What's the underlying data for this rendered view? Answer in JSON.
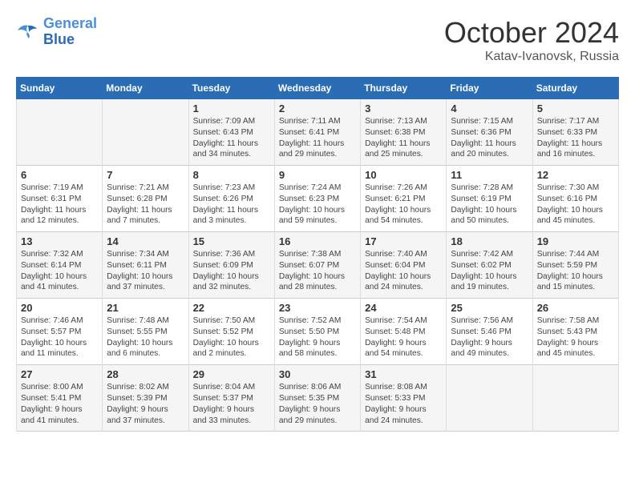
{
  "header": {
    "logo_line1": "General",
    "logo_line2": "Blue",
    "month": "October 2024",
    "location": "Katav-Ivanovsk, Russia"
  },
  "days_of_week": [
    "Sunday",
    "Monday",
    "Tuesday",
    "Wednesday",
    "Thursday",
    "Friday",
    "Saturday"
  ],
  "weeks": [
    [
      {
        "day": "",
        "content": ""
      },
      {
        "day": "",
        "content": ""
      },
      {
        "day": "1",
        "content": "Sunrise: 7:09 AM\nSunset: 6:43 PM\nDaylight: 11 hours\nand 34 minutes."
      },
      {
        "day": "2",
        "content": "Sunrise: 7:11 AM\nSunset: 6:41 PM\nDaylight: 11 hours\nand 29 minutes."
      },
      {
        "day": "3",
        "content": "Sunrise: 7:13 AM\nSunset: 6:38 PM\nDaylight: 11 hours\nand 25 minutes."
      },
      {
        "day": "4",
        "content": "Sunrise: 7:15 AM\nSunset: 6:36 PM\nDaylight: 11 hours\nand 20 minutes."
      },
      {
        "day": "5",
        "content": "Sunrise: 7:17 AM\nSunset: 6:33 PM\nDaylight: 11 hours\nand 16 minutes."
      }
    ],
    [
      {
        "day": "6",
        "content": "Sunrise: 7:19 AM\nSunset: 6:31 PM\nDaylight: 11 hours\nand 12 minutes."
      },
      {
        "day": "7",
        "content": "Sunrise: 7:21 AM\nSunset: 6:28 PM\nDaylight: 11 hours\nand 7 minutes."
      },
      {
        "day": "8",
        "content": "Sunrise: 7:23 AM\nSunset: 6:26 PM\nDaylight: 11 hours\nand 3 minutes."
      },
      {
        "day": "9",
        "content": "Sunrise: 7:24 AM\nSunset: 6:23 PM\nDaylight: 10 hours\nand 59 minutes."
      },
      {
        "day": "10",
        "content": "Sunrise: 7:26 AM\nSunset: 6:21 PM\nDaylight: 10 hours\nand 54 minutes."
      },
      {
        "day": "11",
        "content": "Sunrise: 7:28 AM\nSunset: 6:19 PM\nDaylight: 10 hours\nand 50 minutes."
      },
      {
        "day": "12",
        "content": "Sunrise: 7:30 AM\nSunset: 6:16 PM\nDaylight: 10 hours\nand 45 minutes."
      }
    ],
    [
      {
        "day": "13",
        "content": "Sunrise: 7:32 AM\nSunset: 6:14 PM\nDaylight: 10 hours\nand 41 minutes."
      },
      {
        "day": "14",
        "content": "Sunrise: 7:34 AM\nSunset: 6:11 PM\nDaylight: 10 hours\nand 37 minutes."
      },
      {
        "day": "15",
        "content": "Sunrise: 7:36 AM\nSunset: 6:09 PM\nDaylight: 10 hours\nand 32 minutes."
      },
      {
        "day": "16",
        "content": "Sunrise: 7:38 AM\nSunset: 6:07 PM\nDaylight: 10 hours\nand 28 minutes."
      },
      {
        "day": "17",
        "content": "Sunrise: 7:40 AM\nSunset: 6:04 PM\nDaylight: 10 hours\nand 24 minutes."
      },
      {
        "day": "18",
        "content": "Sunrise: 7:42 AM\nSunset: 6:02 PM\nDaylight: 10 hours\nand 19 minutes."
      },
      {
        "day": "19",
        "content": "Sunrise: 7:44 AM\nSunset: 5:59 PM\nDaylight: 10 hours\nand 15 minutes."
      }
    ],
    [
      {
        "day": "20",
        "content": "Sunrise: 7:46 AM\nSunset: 5:57 PM\nDaylight: 10 hours\nand 11 minutes."
      },
      {
        "day": "21",
        "content": "Sunrise: 7:48 AM\nSunset: 5:55 PM\nDaylight: 10 hours\nand 6 minutes."
      },
      {
        "day": "22",
        "content": "Sunrise: 7:50 AM\nSunset: 5:52 PM\nDaylight: 10 hours\nand 2 minutes."
      },
      {
        "day": "23",
        "content": "Sunrise: 7:52 AM\nSunset: 5:50 PM\nDaylight: 9 hours\nand 58 minutes."
      },
      {
        "day": "24",
        "content": "Sunrise: 7:54 AM\nSunset: 5:48 PM\nDaylight: 9 hours\nand 54 minutes."
      },
      {
        "day": "25",
        "content": "Sunrise: 7:56 AM\nSunset: 5:46 PM\nDaylight: 9 hours\nand 49 minutes."
      },
      {
        "day": "26",
        "content": "Sunrise: 7:58 AM\nSunset: 5:43 PM\nDaylight: 9 hours\nand 45 minutes."
      }
    ],
    [
      {
        "day": "27",
        "content": "Sunrise: 8:00 AM\nSunset: 5:41 PM\nDaylight: 9 hours\nand 41 minutes."
      },
      {
        "day": "28",
        "content": "Sunrise: 8:02 AM\nSunset: 5:39 PM\nDaylight: 9 hours\nand 37 minutes."
      },
      {
        "day": "29",
        "content": "Sunrise: 8:04 AM\nSunset: 5:37 PM\nDaylight: 9 hours\nand 33 minutes."
      },
      {
        "day": "30",
        "content": "Sunrise: 8:06 AM\nSunset: 5:35 PM\nDaylight: 9 hours\nand 29 minutes."
      },
      {
        "day": "31",
        "content": "Sunrise: 8:08 AM\nSunset: 5:33 PM\nDaylight: 9 hours\nand 24 minutes."
      },
      {
        "day": "",
        "content": ""
      },
      {
        "day": "",
        "content": ""
      }
    ]
  ]
}
